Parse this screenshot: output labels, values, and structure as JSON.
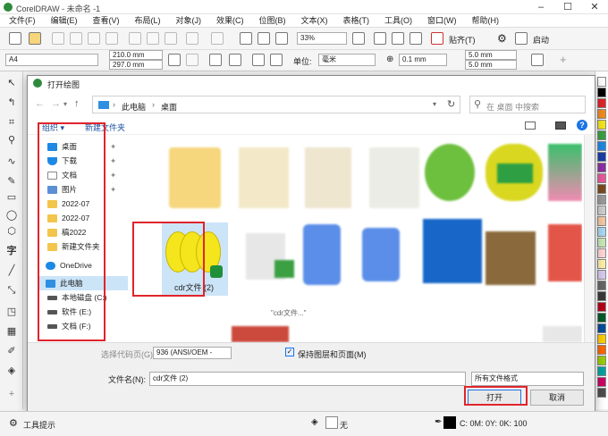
{
  "app": {
    "title": "CorelDRAW - 未命名 -1",
    "logo_letter": "C"
  },
  "window_controls": [
    "–",
    "☐",
    "✕"
  ],
  "menu": [
    "文件(F)",
    "编辑(E)",
    "查看(V)",
    "布局(L)",
    "对象(J)",
    "效果(C)",
    "位图(B)",
    "文本(X)",
    "表格(T)",
    "工具(O)",
    "窗口(W)",
    "帮助(H)"
  ],
  "toolbar": {
    "zoom": "33%",
    "paste_label": "贴齐(T)",
    "start_label": "启动"
  },
  "property_bar": {
    "page_size": "A4",
    "width": "210.0 mm",
    "height": "297.0 mm",
    "unit_label": "单位:",
    "unit_value": "毫米",
    "nudge": "0.1 mm",
    "dup_x": "5.0 mm",
    "dup_y": "5.0 mm"
  },
  "dialog": {
    "title": "打开绘图",
    "breadcrumb": [
      "此电脑",
      "桌面"
    ],
    "search_placeholder": "在 桌面 中搜索",
    "organize": "组织",
    "new_folder": "新建文件夹",
    "help": "?",
    "nav_items": [
      {
        "label": "桌面",
        "icon": "desktop-icon",
        "color": "#1e88e5"
      },
      {
        "label": "下载",
        "icon": "download-icon",
        "color": "#1e88e5"
      },
      {
        "label": "文档",
        "icon": "document-icon",
        "color": "#888888"
      },
      {
        "label": "图片",
        "icon": "picture-icon",
        "color": "#5b8fd6"
      },
      {
        "label": "2022-07",
        "icon": "folder-icon",
        "color": "#f3c54d"
      },
      {
        "label": "2022-07",
        "icon": "folder-icon",
        "color": "#f3c54d"
      },
      {
        "label": "稿2022",
        "icon": "folder-icon",
        "color": "#f3c54d"
      },
      {
        "label": "新建文件夹",
        "icon": "folder-icon",
        "color": "#f3c54d"
      },
      {
        "label": "OneDrive",
        "icon": "cloud-icon",
        "color": "#1e88e5"
      },
      {
        "label": "此电脑",
        "icon": "computer-icon",
        "color": "#2f8fe0"
      },
      {
        "label": "本地磁盘 (C:)",
        "icon": "drive-icon",
        "color": "#555555"
      },
      {
        "label": "软件 (E:)",
        "icon": "drive-icon",
        "color": "#555555"
      },
      {
        "label": "文档 (F:)",
        "icon": "drive-icon",
        "color": "#555555"
      }
    ],
    "selected_file": "cdr文件 (2)",
    "partial_label": "\"cdr文件...\"",
    "codepage_label": "选择代码页(G)",
    "codepage_value": "936  (ANSI/OEM -",
    "keep_layers": "保持图层和页面(M)",
    "keep_layers_checked": true,
    "filename_label": "文件名(N):",
    "filename_value": "cdr文件 (2)",
    "filetype": "所有文件格式",
    "open_button": "打开",
    "cancel_button": "取消"
  },
  "status": {
    "hint": "工具提示",
    "fill": "无",
    "color_readout": "C: 0M: 0Y: 0K: 100"
  },
  "accent_color": "#e0242c"
}
